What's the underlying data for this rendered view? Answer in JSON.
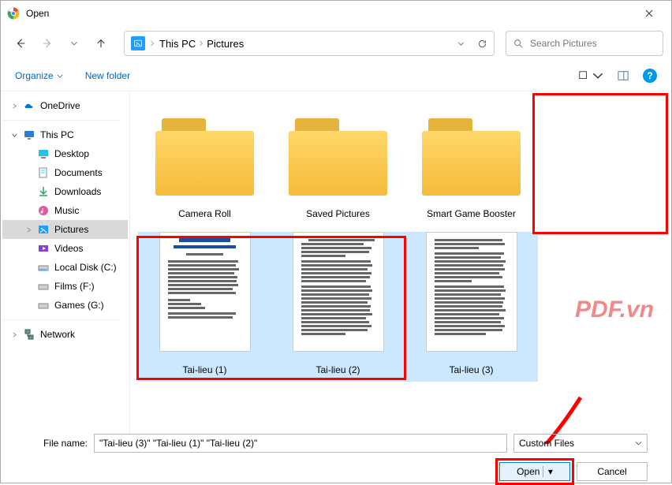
{
  "window": {
    "title": "Open"
  },
  "breadcrumb": {
    "root": "This PC",
    "current": "Pictures"
  },
  "search": {
    "placeholder": "Search Pictures"
  },
  "toolbar": {
    "organize": "Organize",
    "newfolder": "New folder"
  },
  "sidebar": {
    "onedrive": "OneDrive",
    "thispc": "This PC",
    "desktop": "Desktop",
    "documents": "Documents",
    "downloads": "Downloads",
    "music": "Music",
    "pictures": "Pictures",
    "videos": "Videos",
    "localc": "Local Disk (C:)",
    "filmsf": "Films (F:)",
    "gamesg": "Games (G:)",
    "network": "Network"
  },
  "items": {
    "cameraroll": "Camera Roll",
    "savedpictures": "Saved Pictures",
    "smartgame": "Smart Game Booster",
    "tailieu1": "Tai-lieu (1)",
    "tailieu2": "Tai-lieu (2)",
    "tailieu3": "Tai-lieu (3)"
  },
  "filename": {
    "label": "File name:",
    "value": "\"Tai-lieu (3)\" \"Tai-lieu (1)\" \"Tai-lieu (2)\""
  },
  "filter": {
    "label": "Custom Files"
  },
  "buttons": {
    "open": "Open",
    "cancel": "Cancel"
  },
  "watermark": "PDF.vn"
}
